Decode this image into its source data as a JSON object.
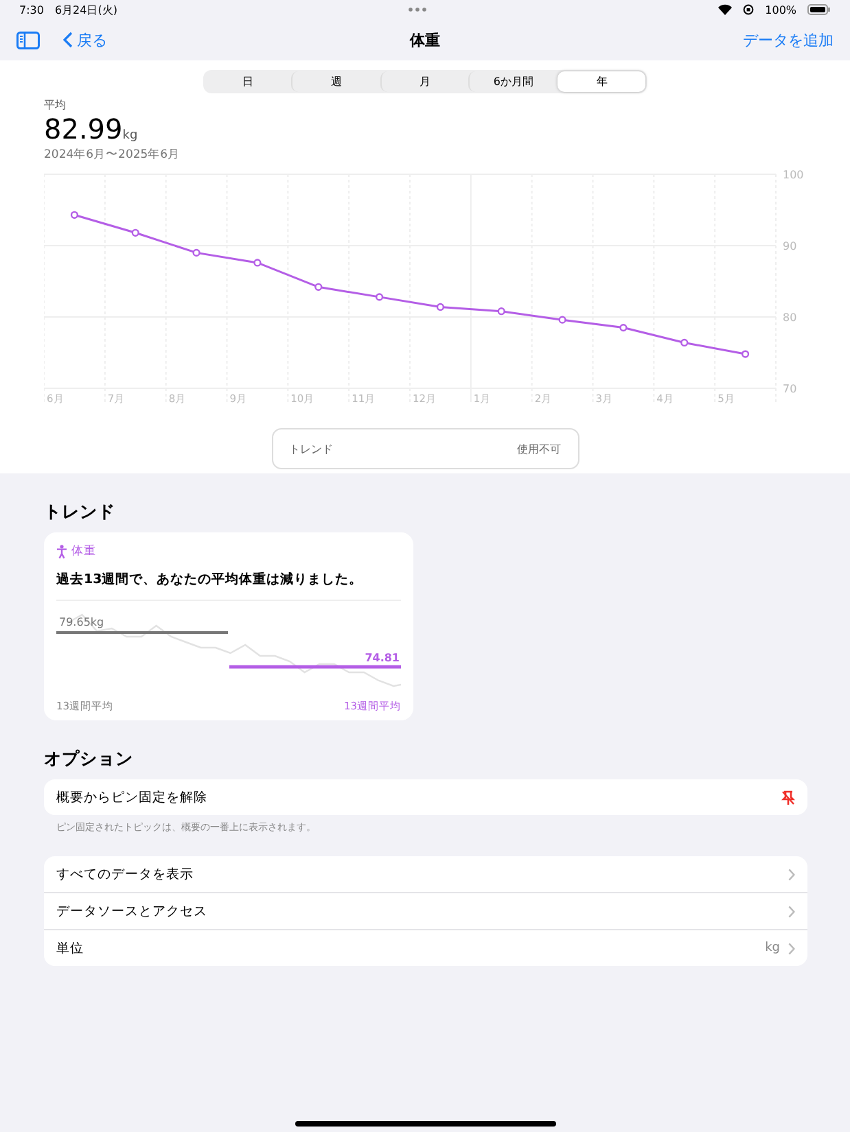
{
  "status_bar": {
    "time": "7:30",
    "date": "6月24日(火)",
    "battery": "100%"
  },
  "nav": {
    "back": "戻る",
    "title": "体重",
    "action": "データを追加"
  },
  "segments": [
    {
      "label": "日",
      "selected": false
    },
    {
      "label": "週",
      "selected": false
    },
    {
      "label": "月",
      "selected": false
    },
    {
      "label": "6か月間",
      "selected": false
    },
    {
      "label": "年",
      "selected": true
    }
  ],
  "summary": {
    "label": "平均",
    "value": "82.99",
    "unit": "kg",
    "range": "2024年6月〜2025年6月"
  },
  "chart_data": {
    "type": "line",
    "categories": [
      "6月",
      "7月",
      "8月",
      "9月",
      "10月",
      "11月",
      "12月",
      "1月",
      "2月",
      "3月",
      "4月",
      "5月"
    ],
    "series": [
      {
        "color": "#b45ee6",
        "marker": true,
        "values": [
          94.3,
          91.8,
          89.0,
          87.6,
          84.2,
          82.8,
          81.4,
          80.8,
          79.6,
          78.5,
          76.4,
          74.8
        ]
      }
    ],
    "ylim": [
      70,
      100
    ],
    "yticks": [
      70,
      80,
      90,
      100
    ]
  },
  "trend_button": {
    "label": "トレンド",
    "value": "使用不可"
  },
  "trend_section": {
    "heading": "トレンド",
    "card_title": "体重",
    "message": "過去13週間で、あなたの平均体重は減りました。",
    "old_value": "79.65kg",
    "new_value": "74.81",
    "old_caption": "13週間平均",
    "new_caption": "13週間平均"
  },
  "options": {
    "heading": "オプション",
    "pin_row": "概要からピン固定を解除",
    "pin_note": "ピン固定されたトピックは、概要の一番上に表示されます。",
    "rows": [
      {
        "label": "すべてのデータを表示"
      },
      {
        "label": "データソースとアクセス"
      },
      {
        "label": "単位",
        "value": "kg"
      }
    ]
  }
}
